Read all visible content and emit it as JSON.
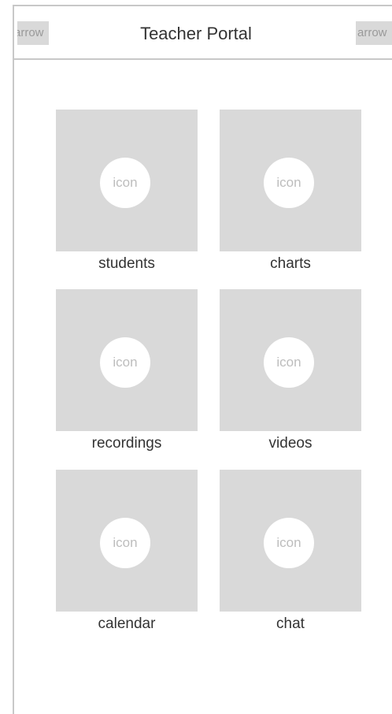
{
  "header": {
    "back_arrow": "arrow",
    "title": "Teacher Portal",
    "forward_arrow": "arrow"
  },
  "tiles": [
    {
      "icon": "icon",
      "label": "students"
    },
    {
      "icon": "icon",
      "label": "charts"
    },
    {
      "icon": "icon",
      "label": "recordings"
    },
    {
      "icon": "icon",
      "label": "videos"
    },
    {
      "icon": "icon",
      "label": "calendar"
    },
    {
      "icon": "icon",
      "label": "chat"
    }
  ],
  "colors": {
    "placeholder": "#d9d9d9",
    "border": "#c8c8c8",
    "text": "#333333"
  }
}
